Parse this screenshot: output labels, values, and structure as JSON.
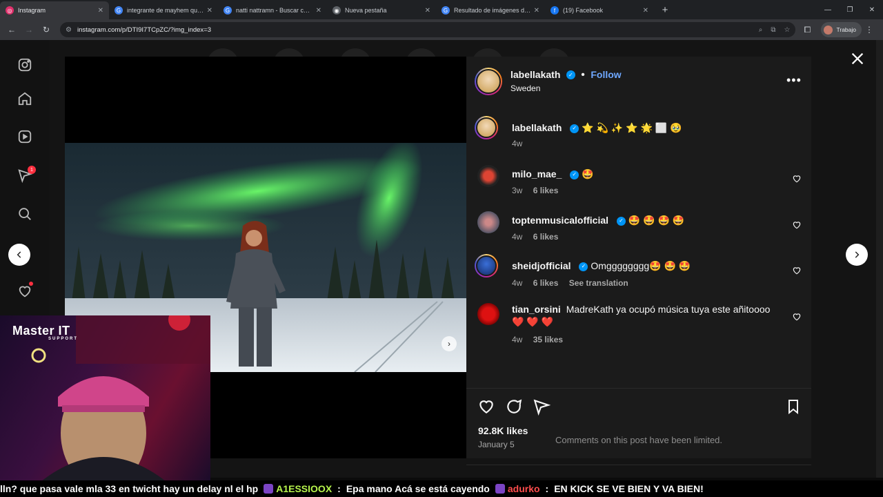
{
  "browser": {
    "tabs": [
      {
        "title": "Instagram",
        "active": true,
        "favicon": "instagram-icon",
        "color": "#e1306c"
      },
      {
        "title": "integrante de mayhem que le t",
        "active": false,
        "favicon": "google-icon",
        "color": "#4285f4"
      },
      {
        "title": "natti nattramn - Buscar con Go",
        "active": false,
        "favicon": "google-icon",
        "color": "#4285f4"
      },
      {
        "title": "Nueva pestaña",
        "active": false,
        "favicon": "chrome-icon",
        "color": "#9aa0a6"
      },
      {
        "title": "Resultado de imágenes de Goo",
        "active": false,
        "favicon": "google-icon",
        "color": "#4285f4"
      },
      {
        "title": "(19) Facebook",
        "active": false,
        "favicon": "facebook-icon",
        "color": "#1877f2"
      }
    ],
    "url": "instagram.com/p/DTI9I7TCpZC/?img_index=3",
    "profile_label": "Trabajo"
  },
  "post": {
    "author": "labellakath",
    "follow_label": "Follow",
    "location": "Sweden",
    "caption": {
      "username": "labellakath",
      "text": "⭐ 💫 ✨ ⭐ 🌟 ⬜ 🥹",
      "age": "4w"
    },
    "comments": [
      {
        "username": "milo_mae_",
        "verified": true,
        "text": "🤩",
        "age": "3w",
        "likes": "6 likes",
        "translation": ""
      },
      {
        "username": "toptenmusicalofficial",
        "verified": true,
        "text": "🤩 🤩 🤩 🤩",
        "age": "4w",
        "likes": "6 likes",
        "translation": ""
      },
      {
        "username": "sheidjofficial",
        "verified": true,
        "text": "Omgggggggg🤩 🤩 🤩",
        "age": "4w",
        "likes": "6 likes",
        "translation": "See translation"
      },
      {
        "username": "tian_orsini",
        "verified": false,
        "text": "MadreKath ya ocupó música tuya este añitoooo ❤️ ❤️ ❤️",
        "age": "4w",
        "likes": "35 likes",
        "translation": ""
      }
    ],
    "likes": "92.8K likes",
    "date": "January 5",
    "limited_notice": "Comments on this post have been limited."
  },
  "overlay": {
    "brand": "Master IT",
    "brand_sub": "SUPPORT"
  },
  "ticker": {
    "seg1": "lln? que pasa vale mla  33  en twicht hay un delay nl el hp",
    "user1": "A1ESSIOOX",
    "seg2": "Epa mano  Acá se está cayendo",
    "user2": "adurko",
    "seg3": "EN KICK SE VE BIEN Y VA BIEN!"
  },
  "colors": {
    "accent": "#0095f6",
    "follow": "#6fa8ff",
    "notif": "#ff3040"
  }
}
